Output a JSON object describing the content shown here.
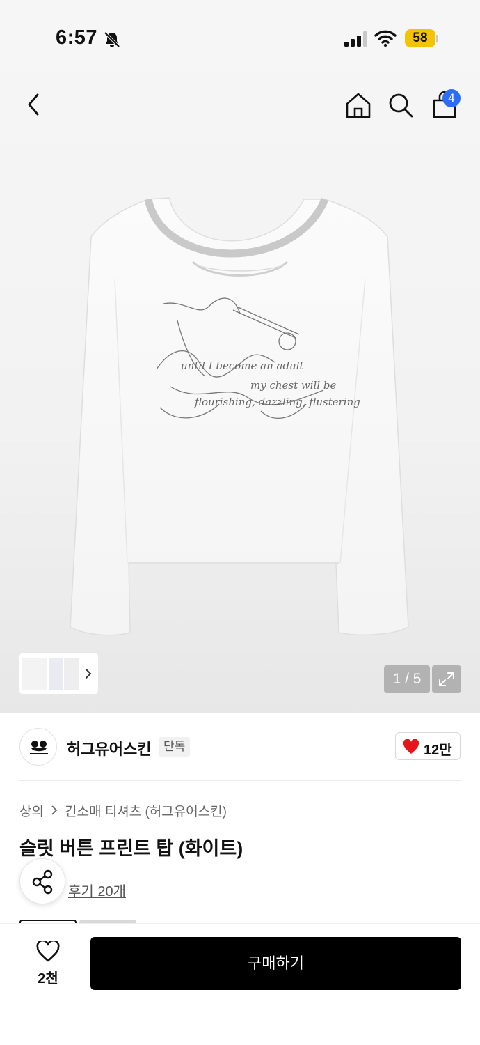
{
  "status_bar": {
    "time": "6:57",
    "battery": "58"
  },
  "nav": {
    "cart_count": "4"
  },
  "gallery": {
    "pager": "1 / 5"
  },
  "brand": {
    "name": "허그유어스킨",
    "tag": "단독",
    "likes": "12만"
  },
  "breadcrumb": {
    "items": [
      "상의",
      "긴소매 티셔츠 (허그유어스킨)"
    ]
  },
  "product": {
    "title": "슬릿 버튼 프린트 탑 (화이트)",
    "reviews": "후기 20개"
  },
  "bottom_bar": {
    "wish_count": "2천",
    "buy_label": "구매하기"
  },
  "colors": {
    "accent_blue": "#2b6df3",
    "heart_red": "#e8141b",
    "buy_button": "#000000",
    "battery_yellow": "#f5c400"
  }
}
